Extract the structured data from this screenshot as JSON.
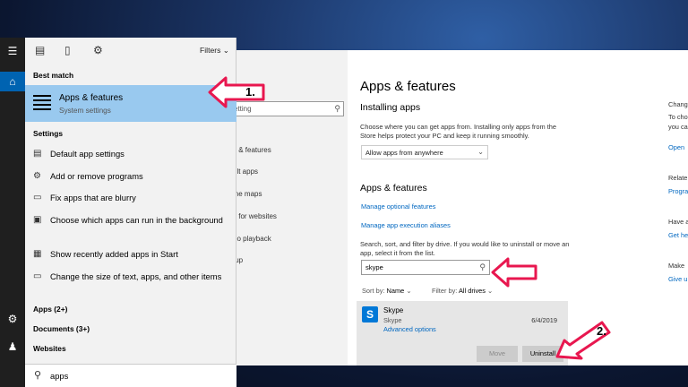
{
  "settings": {
    "nav_search_placeholder": "etting",
    "nav_items": [
      "s & features",
      "ult apps",
      "ine maps",
      "s for websites",
      "eo playback",
      "tup"
    ],
    "title": "Apps & features",
    "installing_heading": "Installing apps",
    "installing_desc": "Choose where you can get apps from. Installing only apps from the Store helps protect your PC and keep it running smoothly.",
    "install_source": "Allow apps from anywhere",
    "features_heading": "Apps & features",
    "link_optional": "Manage optional features",
    "link_aliases": "Manage app execution aliases",
    "search_desc": "Search, sort, and filter by drive. If you would like to uninstall or move an app, select it from the list.",
    "search_value": "skype",
    "sort_label": "Sort by:",
    "sort_value": "Name",
    "filter_label": "Filter by:",
    "filter_value": "All drives",
    "app": {
      "name": "Skype",
      "publisher": "Skype",
      "advanced": "Advanced options",
      "date": "6/4/2019",
      "move_label": "Move",
      "uninstall_label": "Uninstall"
    },
    "right_col": [
      "Chang",
      "To cho",
      "you ca",
      "Open",
      "Relate",
      "Progra",
      "Have a",
      "Get he",
      "Make",
      "Give u"
    ]
  },
  "start": {
    "filters_label": "Filters",
    "best_match_header": "Best match",
    "best_match": {
      "title": "Apps & features",
      "subtitle": "System settings"
    },
    "settings_header": "Settings",
    "settings_items": [
      {
        "icon": "default-apps-icon",
        "text": "Default app settings"
      },
      {
        "icon": "gear-icon",
        "text": "Add or remove programs"
      },
      {
        "icon": "monitor-icon",
        "text": "Fix apps that are blurry"
      },
      {
        "icon": "image-icon",
        "text": "Choose which apps can run in the background"
      },
      {
        "icon": "start-icon",
        "text": "Show recently added apps in Start"
      },
      {
        "icon": "monitor-icon",
        "text": "Change the size of text, apps, and other items"
      }
    ],
    "apps_group": "Apps (2+)",
    "documents_group": "Documents (3+)",
    "websites_group": "Websites",
    "search_query": "apps"
  },
  "callouts": {
    "one": "1.",
    "two": "2."
  },
  "colors": {
    "accent": "#0063b1",
    "highlight": "#99c9ef",
    "callout": "#e8174f",
    "link": "#0067c0"
  }
}
